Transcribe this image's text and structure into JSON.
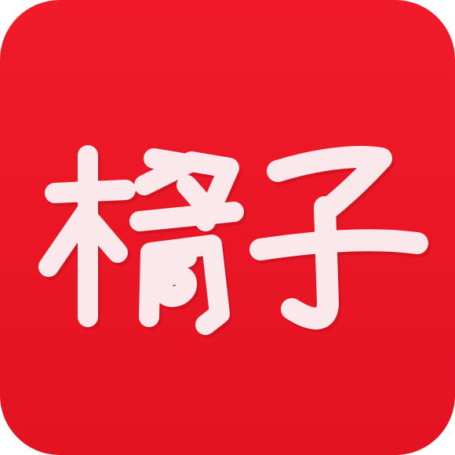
{
  "app_icon": {
    "title": "橘子",
    "characters": [
      "橘",
      "子"
    ],
    "colors": {
      "background": "#f01a2a",
      "background_dark": "#e41322",
      "glyph": "#fbe8ea",
      "glyph_shadow": "#c5101d"
    }
  }
}
